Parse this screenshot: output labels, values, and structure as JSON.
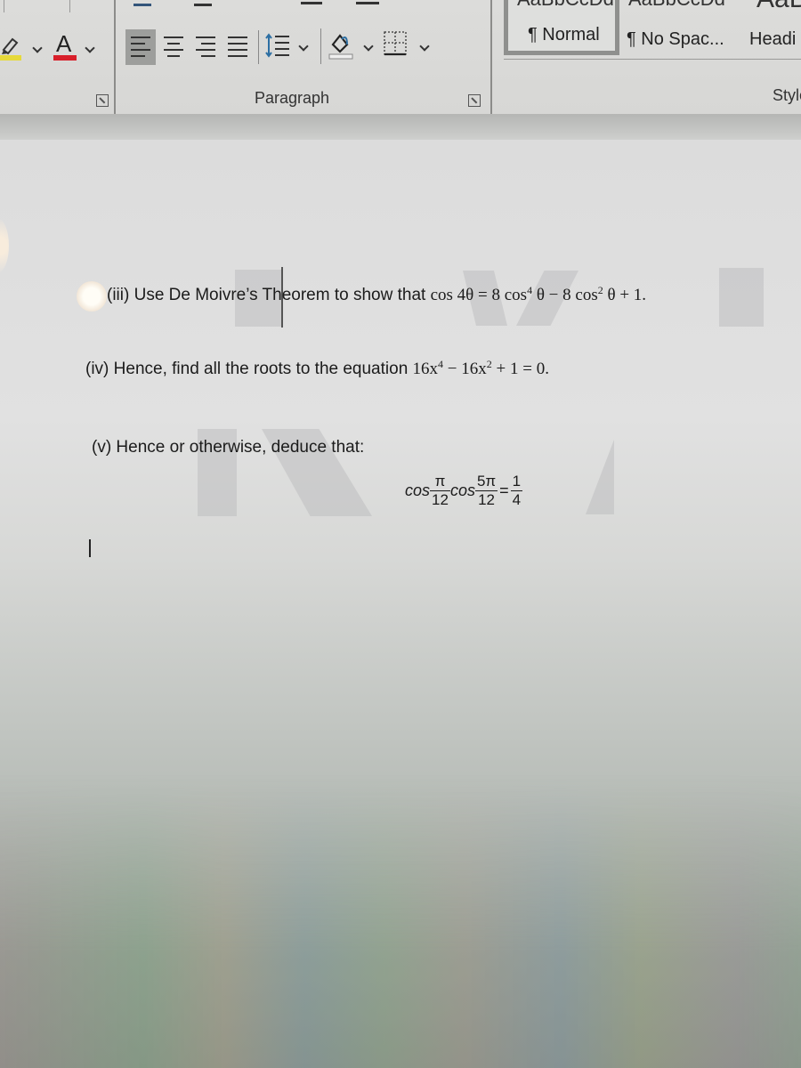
{
  "app": "Microsoft Word",
  "ribbon": {
    "font_group": {
      "highlight_color": "#e6d93a",
      "font_color": "#d81f2a",
      "font_color_letter": "A",
      "launcher_label": "Font settings"
    },
    "paragraph_group": {
      "label": "Paragraph",
      "alignments": [
        {
          "name": "align-left",
          "active": true
        },
        {
          "name": "align-center",
          "active": false
        },
        {
          "name": "align-right",
          "active": false
        },
        {
          "name": "justify",
          "active": false
        }
      ]
    },
    "styles_group": {
      "label": "Styles",
      "label_visible": "Style",
      "items": [
        {
          "name": "Normal",
          "label": "¶ Normal",
          "preview": "AaBbCcDd",
          "active": true
        },
        {
          "name": "No Spacing",
          "label": "¶ No Spac...",
          "preview": "AaBbCcDd",
          "active": false
        },
        {
          "name": "Heading",
          "label": "Headi",
          "preview": "AaB",
          "active": false
        }
      ]
    }
  },
  "document": {
    "questions": [
      {
        "id": "iii",
        "text": "(iii) Use De Moivre’s Theorem to show that ",
        "math": {
          "lhs": "cos 4θ",
          "eq": "=",
          "rhs_parts": [
            "8 cos",
            "4",
            " θ − 8 cos",
            "2",
            " θ + 1."
          ]
        }
      },
      {
        "id": "iv",
        "text": "(iv) Hence, find all the roots to the equation ",
        "math": {
          "parts": [
            "16x",
            "4",
            " − 16x",
            "2",
            " + 1 = 0."
          ]
        }
      },
      {
        "id": "v",
        "text": "(v) Hence or otherwise, deduce that:",
        "math": {
          "cos1": "cos",
          "frac1": {
            "num": "π",
            "den": "12"
          },
          "cos2": "cos",
          "frac2": {
            "num": "5π",
            "den": "12"
          },
          "eq": "=",
          "frac3": {
            "num": "1",
            "den": "4"
          }
        }
      }
    ]
  }
}
